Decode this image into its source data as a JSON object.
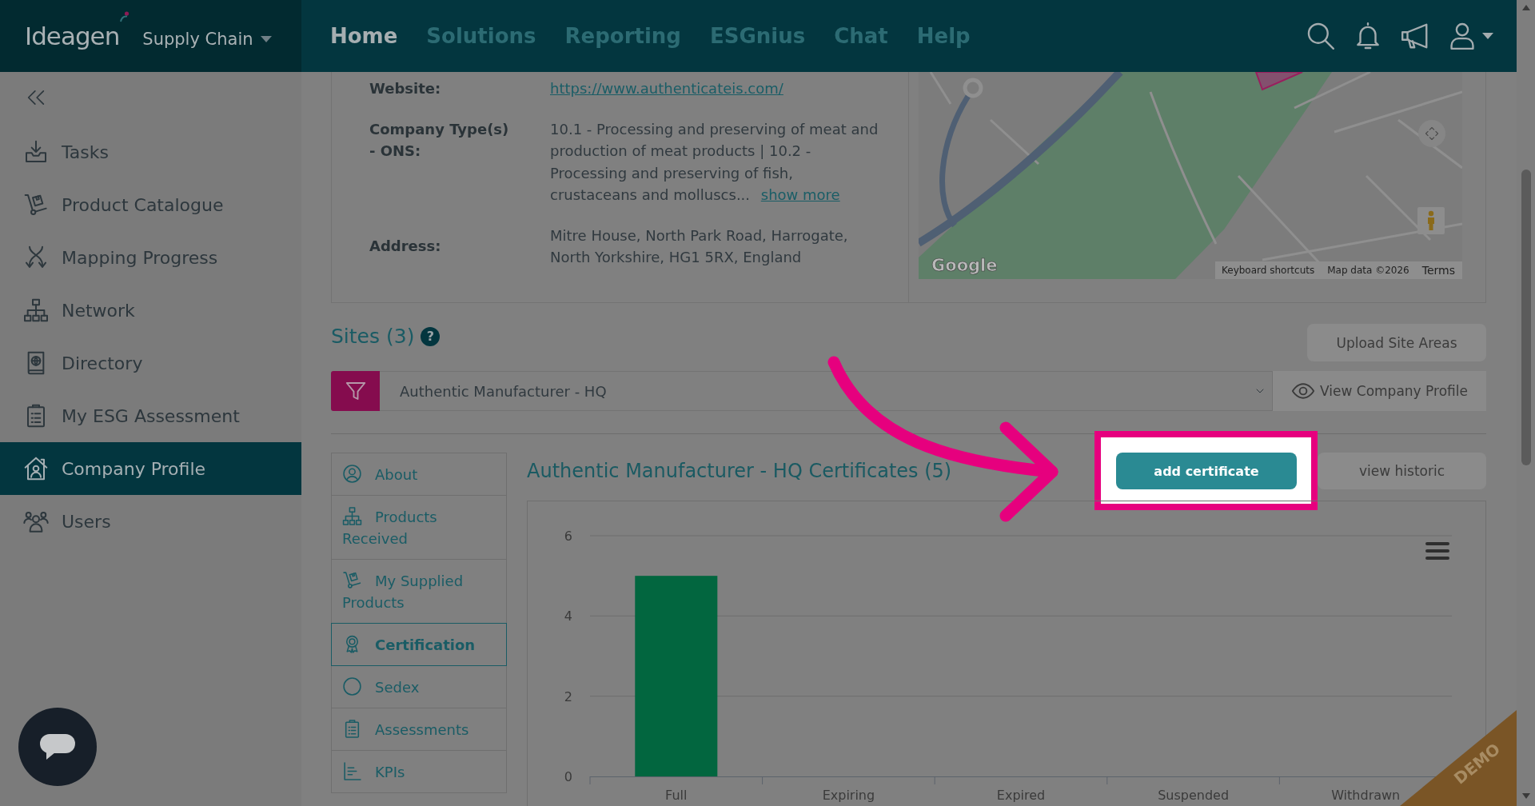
{
  "header": {
    "brand": "Ideagen",
    "product": "Supply Chain",
    "nav": [
      {
        "label": "Home",
        "selected": true
      },
      {
        "label": "Solutions",
        "selected": false
      },
      {
        "label": "Reporting",
        "selected": false
      },
      {
        "label": "ESGnius",
        "selected": false
      },
      {
        "label": "Chat",
        "selected": false
      },
      {
        "label": "Help",
        "selected": false
      }
    ]
  },
  "sidebar": {
    "items": [
      {
        "label": "Tasks",
        "selected": false
      },
      {
        "label": "Product Catalogue",
        "selected": false
      },
      {
        "label": "Mapping Progress",
        "selected": false
      },
      {
        "label": "Network",
        "selected": false
      },
      {
        "label": "Directory",
        "selected": false
      },
      {
        "label": "My ESG Assessment",
        "selected": false
      },
      {
        "label": "Company Profile",
        "selected": true
      },
      {
        "label": "Users",
        "selected": false
      }
    ]
  },
  "company": {
    "fields": [
      {
        "kind": "link",
        "label": "Website:",
        "value": "https://www.authenticateis.com/"
      },
      {
        "kind": "text",
        "label": "Company Type(s) - ONS:",
        "value": "10.1 - Processing and preserving of meat and production of meat products | 10.2 - Processing and preserving of fish, crustaceans and molluscs...",
        "more": "show more"
      },
      {
        "kind": "text",
        "label": "Address:",
        "value": "Mitre House, North Park Road, Harrogate, North Yorkshire, HG1 5RX, England"
      }
    ],
    "map": {
      "logo": "Google",
      "attribution": [
        "Keyboard shortcuts",
        "Map data ©2026",
        "Terms"
      ]
    }
  },
  "sites": {
    "title": "Sites (3)",
    "help": "?",
    "upload_button": "Upload Site Areas",
    "site_select": {
      "value": "Authentic Manufacturer - HQ"
    },
    "view_profile_button": "View Company Profile"
  },
  "site_tabs": [
    {
      "label": "About",
      "selected": false
    },
    {
      "label": "Products Received",
      "selected": false
    },
    {
      "label": "My Supplied Products",
      "selected": false
    },
    {
      "label": "Certification",
      "selected": true
    },
    {
      "label": "Sedex",
      "selected": false
    },
    {
      "label": "Assessments",
      "selected": false
    },
    {
      "label": "KPIs",
      "selected": false
    }
  ],
  "certificates": {
    "title": "Authentic Manufacturer - HQ Certificates (5)",
    "add_button": {
      "label": "add certificate",
      "highlighted": true
    },
    "historic_button": "view historic",
    "chart_data": {
      "type": "bar",
      "categories": [
        "Full",
        "Expiring",
        "Expired",
        "Suspended",
        "Withdrawn"
      ],
      "series": [
        {
          "color": "#02663f",
          "values": [
            5,
            0,
            0,
            0,
            0
          ]
        }
      ],
      "ylim": [
        0,
        6
      ],
      "yticks": [
        0,
        2,
        4,
        6
      ]
    }
  },
  "demo_ribbon": "DEMO"
}
